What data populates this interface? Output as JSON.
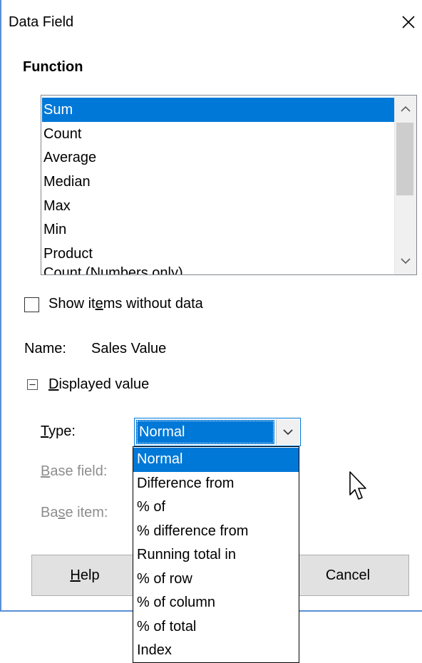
{
  "window": {
    "title": "Data Field"
  },
  "function_section": {
    "heading": "Function",
    "items": [
      "Sum",
      "Count",
      "Average",
      "Median",
      "Max",
      "Min",
      "Product",
      "Count (Numbers only)"
    ],
    "selected": "Sum"
  },
  "show_items": {
    "label_pre": "Show it",
    "label_mnemonic": "e",
    "label_post": "ms without data",
    "checked": false
  },
  "name": {
    "label": "Name:",
    "value": "Sales Value"
  },
  "displayed_value": {
    "label_mnemonic": "D",
    "label_post": "isplayed value",
    "expanded": true
  },
  "type": {
    "label_mnemonic": "T",
    "label_post": "ype:",
    "value": "Normal",
    "options": [
      "Normal",
      "Difference from",
      "% of",
      "% difference from",
      "Running total in",
      "% of row",
      "% of column",
      "% of total",
      "Index"
    ]
  },
  "base_field": {
    "label_mnemonic": "B",
    "label_post": "ase field:"
  },
  "base_item": {
    "label_pre": "Ba",
    "label_mnemonic": "s",
    "label_post": "e item:"
  },
  "buttons": {
    "help_mnemonic": "H",
    "help_post": "elp",
    "cancel": "Cancel"
  },
  "colors": {
    "accent": "#0078d7",
    "disabled": "#8d8d8d",
    "border": "#5a8fd6"
  }
}
